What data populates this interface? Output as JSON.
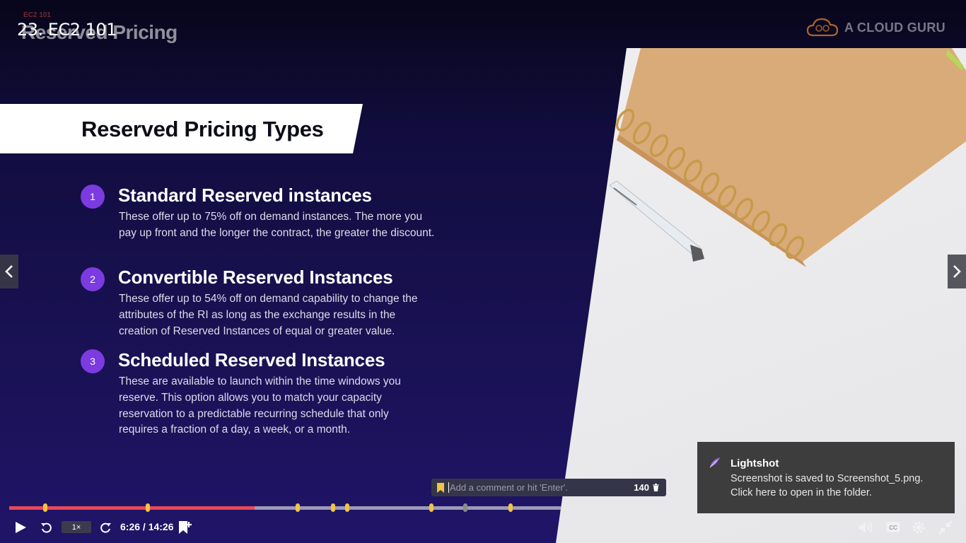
{
  "video": {
    "title": "23. EC2 101",
    "current_time": "6:26",
    "duration": "14:26",
    "time_display": "6:26 / 14:26",
    "playback_speed": "1×",
    "progress": 0.445
  },
  "slide": {
    "kicker": "EC2 101",
    "title": "Reserved Pricing",
    "brand": "A CLOUD GURU",
    "banner_title": "Reserved Pricing Types",
    "items": [
      {
        "number": "1",
        "heading": "Standard Reserved instances",
        "body": "These offer up to 75% off on demand instances. The more you pay up front and the longer the contract, the greater the discount."
      },
      {
        "number": "2",
        "heading": "Convertible Reserved Instances",
        "body": "These offer up to 54% off on demand capability to change the attributes of the RI as long as the exchange results in the creation of Reserved Instances of equal or greater value."
      },
      {
        "number": "3",
        "heading": "Scheduled Reserved Instances",
        "body": "These are available to launch within the time windows you reserve. This option allows you to match your capacity reservation to a predictable recurring schedule that only requires a fraction of a day, a week, or a month."
      }
    ]
  },
  "comment": {
    "placeholder": "Add a comment or hit 'Enter'.",
    "char_count": "140"
  },
  "toast": {
    "app": "Lightshot",
    "message": "Screenshot is saved to Screenshot_5.png. Click here to open in the folder."
  },
  "colors": {
    "timeline_played": "#e9485a",
    "timeline_marker": "#f2c444",
    "accent_purple": "#7b3be0"
  }
}
